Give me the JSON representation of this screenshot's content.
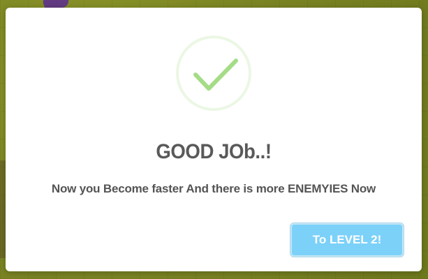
{
  "dialog": {
    "icon": "success-check-icon",
    "title": "GOOD JOb..!",
    "message": "Now you Become faster And there is more ENEMYIES Now",
    "confirm_label": "To LEVEL 2!"
  },
  "colors": {
    "check": "#a5dc86",
    "button": "#7cd1f9",
    "text": "#595959",
    "background": "#8f9a2a"
  }
}
